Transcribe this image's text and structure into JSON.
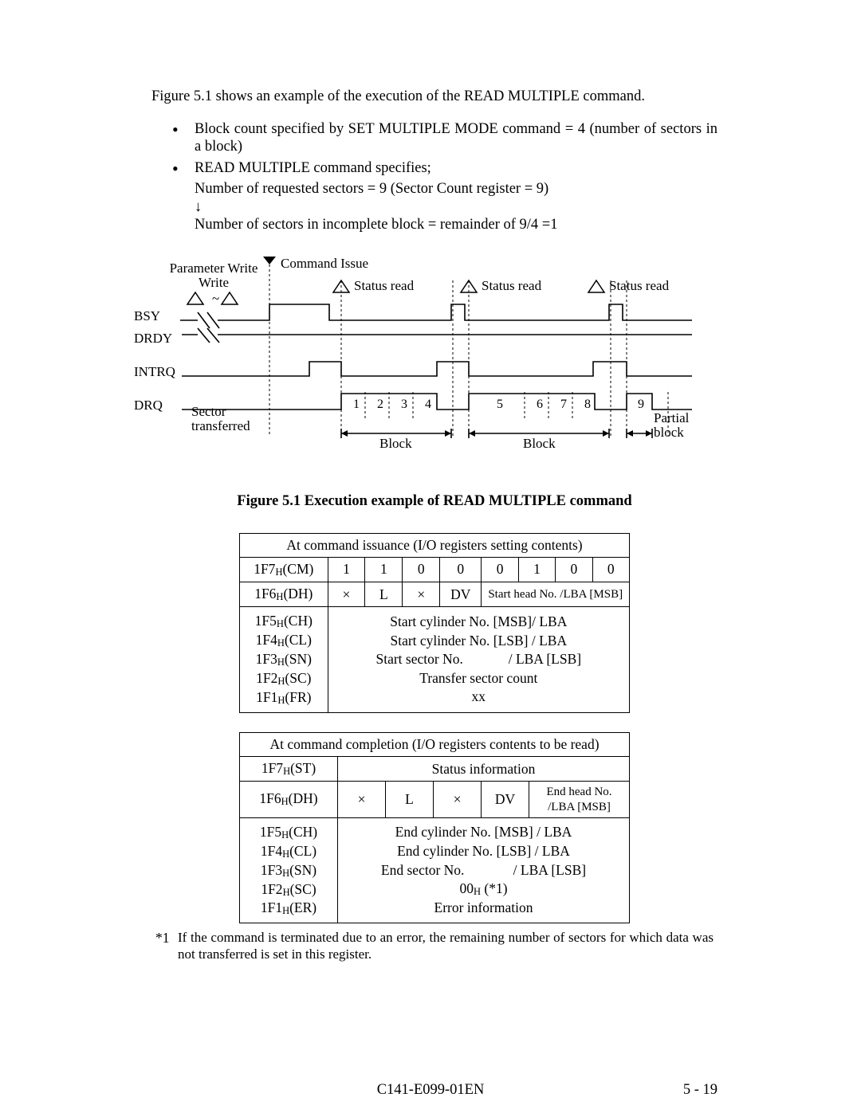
{
  "intro": "Figure 5.1 shows an example of the execution of the READ MULTIPLE command.",
  "bullet1": "Block count specified by SET MULTIPLE MODE command = 4 (number of sectors in a block)",
  "bullet2": "READ MULTIPLE command specifies;",
  "sub1": "Number of requested sectors = 9 (Sector Count register = 9)",
  "arrow": "↓",
  "sub2": "Number of sectors in incomplete block = remainder of 9/4 =1",
  "diagram": {
    "param_write": "Parameter Write",
    "cmd_issue": "Command Issue",
    "status_read": "Status read",
    "BSY": "BSY",
    "DRDY": "DRDY",
    "INTRQ": "INTRQ",
    "DRQ": "DRQ",
    "sector_transferred": "Sector transferred",
    "block": "Block",
    "partial_block": "Partial block",
    "nums": [
      "1",
      "2",
      "3",
      "4",
      "5",
      "6",
      "7",
      "8",
      "9"
    ]
  },
  "fig_caption": "Figure 5.1    Execution example of READ MULTIPLE command",
  "table1": {
    "title": "At command issuance (I/O registers setting contents)",
    "rows": {
      "CM": {
        "label_reg": "1F7",
        "label_suf": "(CM)",
        "bits": [
          "1",
          "1",
          "0",
          "0",
          "0",
          "1",
          "0",
          "0"
        ]
      },
      "DH": {
        "label_reg": "1F6",
        "label_suf": "(DH)",
        "c1": "×",
        "c2": "L",
        "c3": "×",
        "c4": "DV",
        "c5": "Start head No. /LBA [MSB]"
      },
      "CH": {
        "label_reg": "1F5",
        "label_suf": "(CH)",
        "val": "Start cylinder No. [MSB]/ LBA"
      },
      "CL": {
        "label_reg": "1F4",
        "label_suf": "(CL)",
        "val": "Start cylinder No. [LSB] / LBA"
      },
      "SN": {
        "label_reg": "1F3",
        "label_suf": "(SN)",
        "valL": "Start sector No.",
        "valR": "/ LBA [LSB]"
      },
      "SC": {
        "label_reg": "1F2",
        "label_suf": "(SC)",
        "val": "Transfer sector count"
      },
      "FR": {
        "label_reg": "1F1",
        "label_suf": "(FR)",
        "val": "xx"
      }
    }
  },
  "table2": {
    "title": "At command completion (I/O registers contents to be read)",
    "rows": {
      "ST": {
        "label_reg": "1F7",
        "label_suf": "(ST)",
        "val": "Status information"
      },
      "DH": {
        "label_reg": "1F6",
        "label_suf": "(DH)",
        "c1": "×",
        "c2": "L",
        "c3": "×",
        "c4": "DV",
        "c5": "End head No. /LBA [MSB]"
      },
      "CH": {
        "label_reg": "1F5",
        "label_suf": "(CH)",
        "val": "End cylinder No. [MSB] / LBA"
      },
      "CL": {
        "label_reg": "1F4",
        "label_suf": "(CL)",
        "val": "End cylinder No. [LSB]  / LBA"
      },
      "SN": {
        "label_reg": "1F3",
        "label_suf": "(SN)",
        "valL": "End sector No.",
        "valR": "/ LBA [LSB]"
      },
      "SC": {
        "label_reg": "1F2",
        "label_suf": "(SC)",
        "val_pre": "00",
        "val_suf": " (*1)"
      },
      "ER": {
        "label_reg": "1F1",
        "label_suf": "(ER)",
        "val": "Error information"
      }
    }
  },
  "note_mark": "*1",
  "note": "If the command is terminated due to an error, the remaining number of sectors for which data was not transferred is set in this register.",
  "doc_id": "C141-E099-01EN",
  "page_num": "5 - 19",
  "sub_H": "H"
}
